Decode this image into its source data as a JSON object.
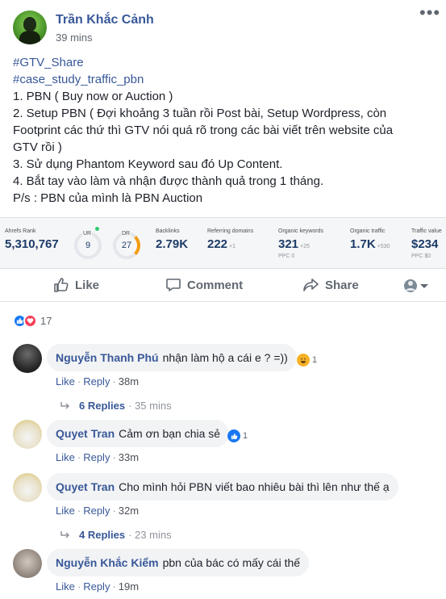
{
  "post": {
    "author": "Trần Khắc Cảnh",
    "time": "39 mins",
    "more_label": "•••",
    "lines": [
      "#GTV_Share",
      "#case_study_traffic_pbn",
      "1. PBN ( Buy now or Auction )",
      "2. Setup PBN ( Đợi khoảng 3 tuần rồi Post bài, Setup Wordpress, còn",
      "Footprint các thứ thì GTV nói quá rõ trong các bài viết trên website của",
      "GTV rồi )",
      "3. Sử dụng Phantom Keyword sau đó Up Content.",
      "4. Bắt tay vào làm và nhận được thành quả trong 1 tháng.",
      "P/s : PBN của mình là PBN Auction"
    ]
  },
  "stats": {
    "ahrefs_rank_label": "Ahrefs Rank",
    "ahrefs_rank_value": "5,310,767",
    "ur_label": "UR",
    "ur_value": "9",
    "dr_label": "DR",
    "dr_value": "27",
    "backlinks_label": "Backlinks",
    "backlinks_value": "2.79K",
    "referring_label": "Referring domains",
    "referring_value": "222",
    "referring_delta": "+1",
    "organic_kw_label": "Organic keywords",
    "organic_kw_value": "321",
    "organic_kw_delta": "+25",
    "organic_kw_sub": "PPC 0",
    "organic_traffic_label": "Organic traffic",
    "organic_traffic_value": "1.7K",
    "organic_traffic_delta": "+530",
    "traffic_value_label": "Traffic value",
    "traffic_value_value": "$234",
    "traffic_value_sub": "PPC $0"
  },
  "actions": {
    "like": "Like",
    "comment": "Comment",
    "share": "Share"
  },
  "reactions": {
    "count": "17"
  },
  "comments": [
    {
      "name": "Nguyễn Thanh Phú",
      "text": "nhận làm hộ a cái e ? =))",
      "reaction_count": "1",
      "like": "Like",
      "reply": "Reply",
      "time": "38m",
      "replies": "6 Replies",
      "replies_time": "35 mins"
    },
    {
      "name": "Quyet Tran",
      "text": "Cảm ơn bạn chia sẻ",
      "reaction_count": "1",
      "like": "Like",
      "reply": "Reply",
      "time": "33m"
    },
    {
      "name": "Quyet Tran",
      "text": "Cho mình hỏi PBN viết bao nhiêu bài thì lên như thế ạ",
      "like": "Like",
      "reply": "Reply",
      "time": "32m",
      "replies": "4 Replies",
      "replies_time": "23 mins"
    },
    {
      "name": "Nguyễn Khắc Kiểm",
      "text": "pbn của bác có mấy cái thế",
      "like": "Like",
      "reply": "Reply",
      "time": "19m"
    }
  ],
  "colors": {
    "link": "#385898",
    "like_blue": "#1877f2",
    "love_red": "#f33e58"
  }
}
